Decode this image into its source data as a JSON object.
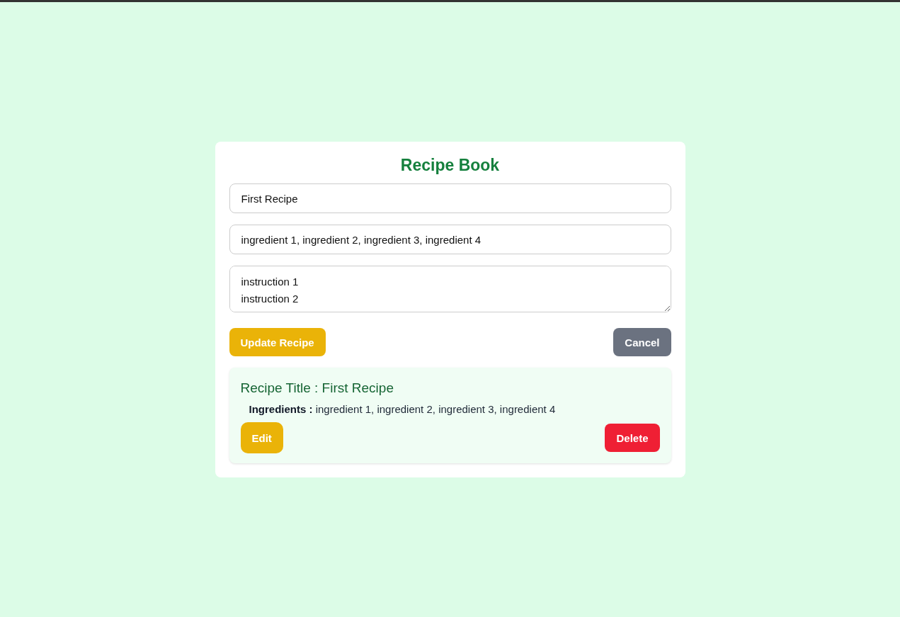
{
  "title": "Recipe Book",
  "form": {
    "title_value": "First Recipe",
    "ingredients_value": "ingredient 1, ingredient 2, ingredient 3, ingredient 4",
    "instructions_value": "instruction 1\ninstruction 2",
    "submit_label": "Update Recipe",
    "cancel_label": "Cancel"
  },
  "recipes": [
    {
      "title_label": "Recipe Title :",
      "title": "First Recipe",
      "ingredients_label": "Ingredients :",
      "ingredients": "ingredient 1, ingredient 2, ingredient 3, ingredient 4",
      "edit_label": "Edit",
      "delete_label": "Delete"
    }
  ]
}
